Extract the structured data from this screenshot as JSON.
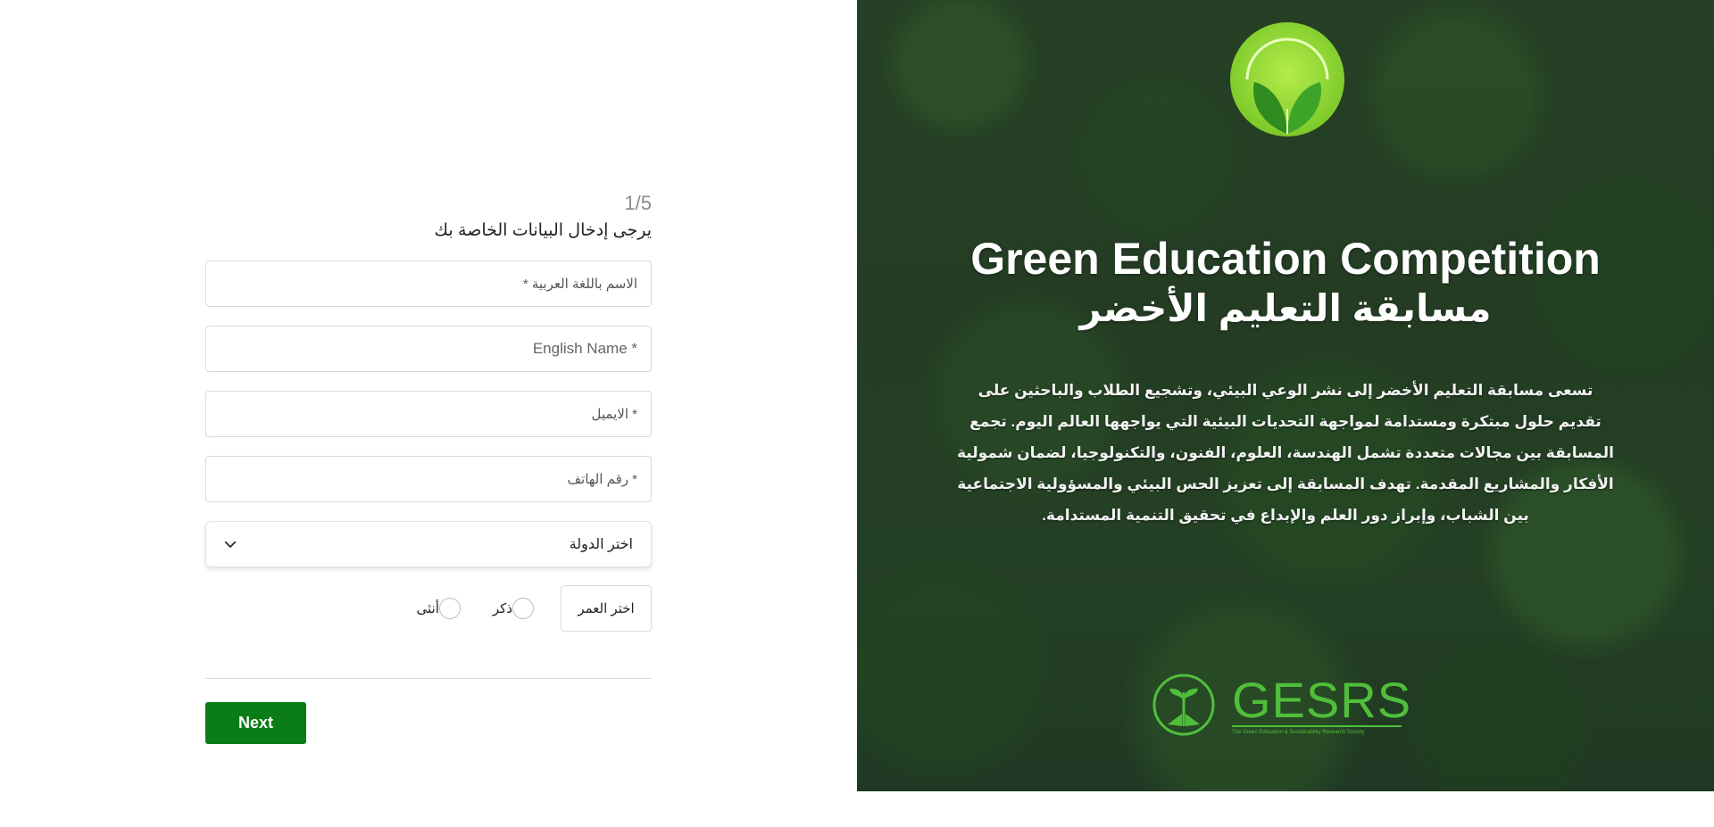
{
  "form": {
    "step": "1/5",
    "subtitle": "يرجى إدخال البيانات الخاصة بك",
    "fields": {
      "arabic_name_placeholder": "الاسم باللغة العربية *",
      "english_name_placeholder": "* English Name",
      "email_placeholder": "* الايميل",
      "phone_placeholder": "* رقم الهاتف"
    },
    "country_select": "اختر الدولة",
    "age_select": "اختر العمر",
    "gender": {
      "male": "ذكر",
      "female": "أنثى"
    },
    "next_label": "Next",
    "next_color": "#0a7d16"
  },
  "hero": {
    "title_en": "Green Education Competition",
    "title_ar": "مسابقة التعليم الأخضر",
    "description": "تسعى مسابقة التعليم الأخضر إلى نشر الوعي البيئي، وتشجيع الطلاب والباحثين على تقديم حلول مبتكرة ومستدامة لمواجهة التحديات البيئية التي يواجهها العالم اليوم. تجمع المسابقة بين مجالات متعددة تشمل الهندسة، العلوم، الفنون، والتكنولوجيا، لضمان شمولية الأفكار والمشاريع المقدمة. تهدف المسابقة إلى تعزيز الحس البيئي والمسؤولية الاجتماعية بين الشباب، وإبراز دور العلم والإبداع في تحقيق التنمية المستدامة.",
    "logo_ring_text": "مسابقة التعليم الأخضر",
    "org_logo_text": "GESRS",
    "org_logo_subtext": "The Green Education & Sustainability Research Society",
    "accent_color": "#4fbf3a"
  }
}
